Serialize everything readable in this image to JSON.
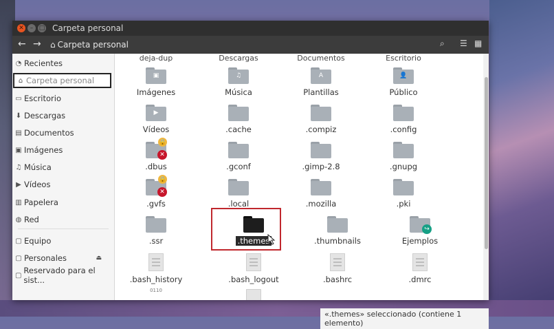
{
  "window": {
    "title": "Carpeta personal",
    "close": "✕",
    "min": "–",
    "max": "□"
  },
  "toolbar": {
    "back": "←",
    "forward": "→",
    "breadcrumb": "Carpeta personal",
    "home_glyph": "⌂",
    "search": "⌕",
    "list_view": "☰",
    "grid_view": "▦"
  },
  "sidebar": {
    "items": [
      {
        "label": "Recientes",
        "icon": "clock-icon",
        "glyph": "◔"
      },
      {
        "label": "Carpeta personal",
        "icon": "home-icon",
        "glyph": "⌂"
      },
      {
        "label": "Escritorio",
        "icon": "desktop-icon",
        "glyph": "▭"
      },
      {
        "label": "Descargas",
        "icon": "download-icon",
        "glyph": "⬇"
      },
      {
        "label": "Documentos",
        "icon": "document-icon",
        "glyph": "▤"
      },
      {
        "label": "Imágenes",
        "icon": "image-icon",
        "glyph": "▣"
      },
      {
        "label": "Música",
        "icon": "music-icon",
        "glyph": "♫"
      },
      {
        "label": "Vídeos",
        "icon": "video-icon",
        "glyph": "▶"
      },
      {
        "label": "Papelera",
        "icon": "trash-icon",
        "glyph": "▥"
      },
      {
        "label": "Red",
        "icon": "network-icon",
        "glyph": "◍"
      },
      {
        "label": "Equipo",
        "icon": "computer-icon",
        "glyph": "▢"
      },
      {
        "label": "Personales",
        "icon": "drive-icon",
        "glyph": "▢"
      },
      {
        "label": "Reservado para el sist...",
        "icon": "drive-icon",
        "glyph": "▢"
      }
    ],
    "eject": "⏏"
  },
  "top_row": [
    "deja-dup",
    "Descargas",
    "Documentos",
    "Escritorio"
  ],
  "files": [
    {
      "label": "Imágenes",
      "kind": "folder",
      "glyph": "▣"
    },
    {
      "label": "Música",
      "kind": "folder",
      "glyph": "♫"
    },
    {
      "label": "Plantillas",
      "kind": "folder",
      "glyph": "A"
    },
    {
      "label": "Público",
      "kind": "folder",
      "glyph": "👤"
    },
    {
      "label": "Vídeos",
      "kind": "folder",
      "glyph": "▶"
    },
    {
      "label": ".cache",
      "kind": "folder"
    },
    {
      "label": ".compiz",
      "kind": "folder"
    },
    {
      "label": ".config",
      "kind": "folder"
    },
    {
      "label": ".dbus",
      "kind": "folder-locked"
    },
    {
      "label": ".gconf",
      "kind": "folder"
    },
    {
      "label": ".gimp-2.8",
      "kind": "folder"
    },
    {
      "label": ".gnupg",
      "kind": "folder"
    },
    {
      "label": ".gvfs",
      "kind": "folder-locked"
    },
    {
      "label": ".local",
      "kind": "folder"
    },
    {
      "label": ".mozilla",
      "kind": "folder"
    },
    {
      "label": ".pki",
      "kind": "folder"
    },
    {
      "label": ".ssr",
      "kind": "folder"
    },
    {
      "label": ".themes",
      "kind": "folder-selected"
    },
    {
      "label": ".thumbnails",
      "kind": "folder"
    },
    {
      "label": "Ejemplos",
      "kind": "folder-link"
    },
    {
      "label": ".bash_history",
      "kind": "text"
    },
    {
      "label": ".bash_logout",
      "kind": "text"
    },
    {
      "label": ".bashrc",
      "kind": "text"
    },
    {
      "label": ".dmrc",
      "kind": "text"
    }
  ],
  "badges": {
    "lock": "🔒",
    "x": "✕",
    "link": "↪"
  },
  "bottom_glyph": "0110",
  "status": "«.themes» seleccionado  (contiene 1 elemento)"
}
